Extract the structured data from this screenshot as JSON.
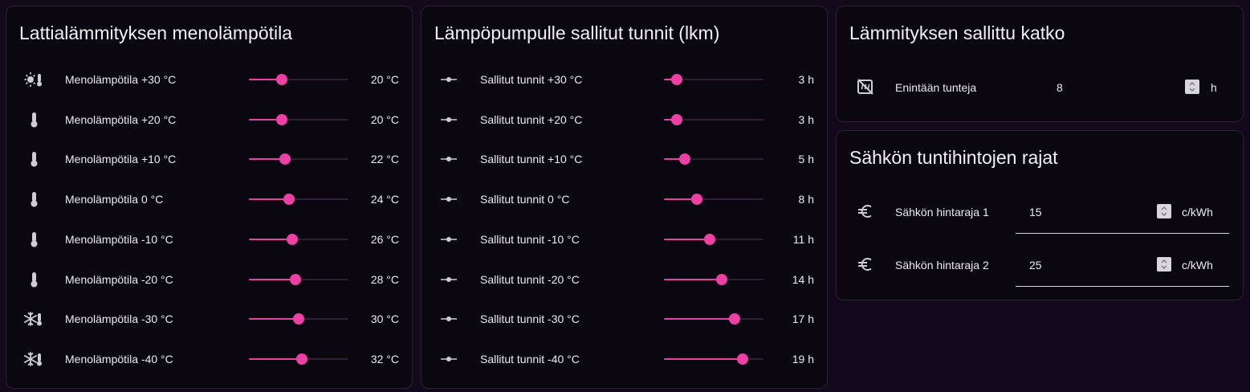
{
  "accent_color": "#e83fa2",
  "panels": {
    "flow": {
      "title": "Lattialämmityksen menolämpötila",
      "min": 0,
      "max": 60,
      "rows": [
        {
          "label": "Menolämpötila +30 °C",
          "value": 20,
          "display": "20 °C",
          "icon": "sun-thermometer-icon"
        },
        {
          "label": "Menolämpötila +20 °C",
          "value": 20,
          "display": "20 °C",
          "icon": "thermometer-icon"
        },
        {
          "label": "Menolämpötila +10 °C",
          "value": 22,
          "display": "22 °C",
          "icon": "thermometer-icon"
        },
        {
          "label": "Menolämpötila 0 °C",
          "value": 24,
          "display": "24 °C",
          "icon": "thermometer-icon"
        },
        {
          "label": "Menolämpötila -10 °C",
          "value": 26,
          "display": "26 °C",
          "icon": "thermometer-icon"
        },
        {
          "label": "Menolämpötila -20 °C",
          "value": 28,
          "display": "28 °C",
          "icon": "thermometer-icon"
        },
        {
          "label": "Menolämpötila -30 °C",
          "value": 30,
          "display": "30 °C",
          "icon": "snowflake-thermometer-icon"
        },
        {
          "label": "Menolämpötila -40 °C",
          "value": 32,
          "display": "32 °C",
          "icon": "snowflake-thermometer-icon"
        }
      ]
    },
    "hours": {
      "title": "Lämpöpumpulle sallitut tunnit (lkm)",
      "min": 0,
      "max": 24,
      "rows": [
        {
          "label": "Sallitut tunnit +30 °C",
          "value": 3,
          "display": "3 h",
          "icon": "slider-icon"
        },
        {
          "label": "Sallitut tunnit +20 °C",
          "value": 3,
          "display": "3 h",
          "icon": "slider-icon"
        },
        {
          "label": "Sallitut tunnit +10 °C",
          "value": 5,
          "display": "5 h",
          "icon": "slider-icon"
        },
        {
          "label": "Sallitut tunnit 0 °C",
          "value": 8,
          "display": "8 h",
          "icon": "slider-icon"
        },
        {
          "label": "Sallitut tunnit -10 °C",
          "value": 11,
          "display": "11 h",
          "icon": "slider-icon"
        },
        {
          "label": "Sallitut tunnit -20 °C",
          "value": 14,
          "display": "14 h",
          "icon": "slider-icon"
        },
        {
          "label": "Sallitut tunnit -30 °C",
          "value": 17,
          "display": "17 h",
          "icon": "slider-icon"
        },
        {
          "label": "Sallitut tunnit -40 °C",
          "value": 19,
          "display": "19 h",
          "icon": "slider-icon"
        }
      ]
    },
    "break": {
      "title": "Lämmityksen sallittu katko",
      "field": {
        "label": "Enintään tunteja",
        "value": "8",
        "unit": "h",
        "icon": "heating-off-icon"
      }
    },
    "price": {
      "title": "Sähkön tuntihintojen rajat",
      "fields": [
        {
          "label": "Sähkön hintaraja 1",
          "value": "15",
          "unit": "c/kWh",
          "icon": "euro-icon"
        },
        {
          "label": "Sähkön hintaraja 2",
          "value": "25",
          "unit": "c/kWh",
          "icon": "euro-icon"
        }
      ]
    }
  }
}
